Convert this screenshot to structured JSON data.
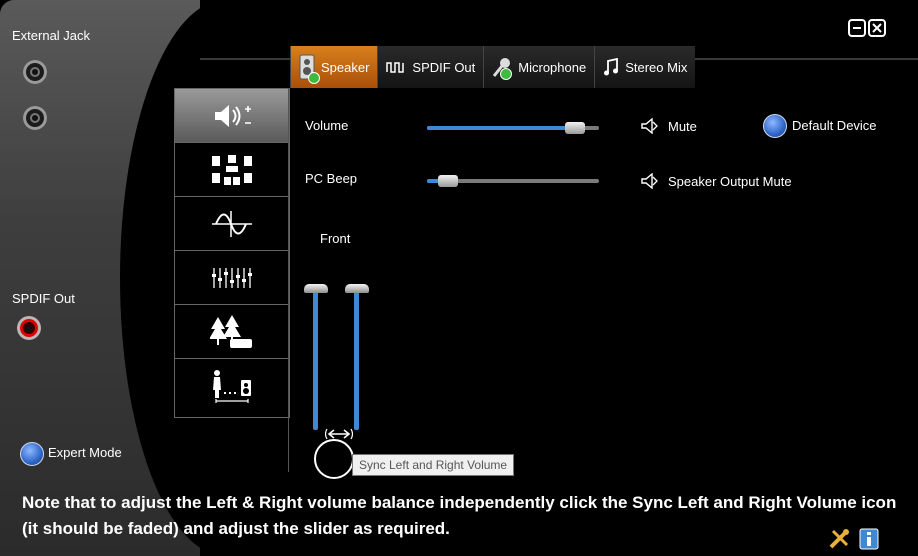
{
  "left_panel": {
    "external_jack_label": "External Jack",
    "spdif_out_label": "SPDIF Out",
    "expert_mode_label": "Expert Mode"
  },
  "tabs": [
    {
      "label": "Speaker",
      "icon": "speaker-icon",
      "active": true
    },
    {
      "label": "SPDIF Out",
      "icon": "spdif-wave-icon",
      "active": false
    },
    {
      "label": "Microphone",
      "icon": "microphone-icon",
      "active": false
    },
    {
      "label": "Stereo Mix",
      "icon": "music-note-icon",
      "active": false
    }
  ],
  "side_tabs": [
    {
      "name": "volume-tab",
      "icon": "speaker-volume-icon",
      "active": true
    },
    {
      "name": "speaker-config-tab",
      "icon": "speaker-array-icon",
      "active": false
    },
    {
      "name": "sound-effects-tab",
      "icon": "waveform-icon",
      "active": false
    },
    {
      "name": "equalizer-tab",
      "icon": "equalizer-icon",
      "active": false
    },
    {
      "name": "environment-tab",
      "icon": "room-environment-icon",
      "active": false
    },
    {
      "name": "room-correction-tab",
      "icon": "listener-distance-icon",
      "active": false
    }
  ],
  "controls": {
    "volume_label": "Volume",
    "volume_level": 0.86,
    "pc_beep_label": "PC Beep",
    "pc_beep_level": 0.12,
    "mute_label": "Mute",
    "speaker_output_mute_label": "Speaker Output Mute",
    "default_device_label": "Default Device",
    "front_label": "Front",
    "front_left_level": 1.0,
    "front_right_level": 1.0
  },
  "tooltip": "Sync Left and Right Volume",
  "note": "Note that to adjust the Left & Right volume balance independently click the Sync Left and Right Volume icon (it should be faded) and adjust the slider as required.",
  "colors": {
    "accent_orange": "#c8691a",
    "slider_blue": "#3e88d4",
    "status_green": "#3dbb3d",
    "jack_red": "#e00000"
  }
}
